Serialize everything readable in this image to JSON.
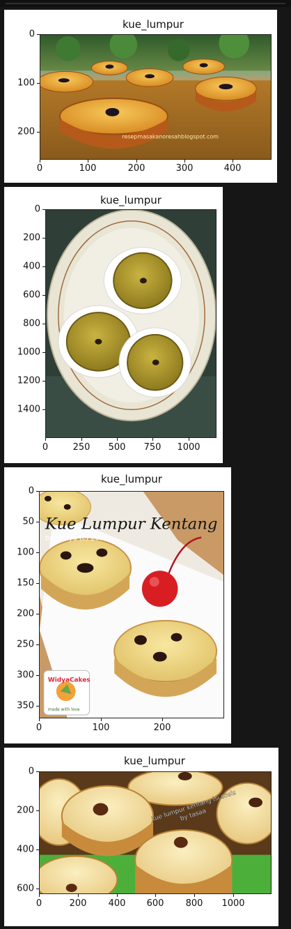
{
  "panels": [
    {
      "title": "kue_lumpur",
      "yticks": [
        "0",
        "100",
        "200"
      ],
      "xticks": [
        "0",
        "100",
        "200",
        "300",
        "400"
      ],
      "watermark": "resepmasakanoresahblogspot.com"
    },
    {
      "title": "kue_lumpur",
      "yticks": [
        "0",
        "200",
        "400",
        "600",
        "800",
        "1000",
        "1200",
        "1400"
      ],
      "xticks": [
        "0",
        "250",
        "500",
        "750",
        "1000"
      ]
    },
    {
      "title": "kue_lumpur",
      "yticks": [
        "0",
        "50",
        "100",
        "150",
        "200",
        "250",
        "300",
        "350"
      ],
      "xticks": [
        "0",
        "100",
        "200"
      ],
      "overlay_title": "Kue Lumpur Kentang",
      "overlay_sub": "by Widya (c) 2010",
      "logo_text": "WidyaCakes",
      "logo_sub": "made with love"
    },
    {
      "title": "kue_lumpur",
      "yticks": [
        "0",
        "200",
        "400",
        "600"
      ],
      "xticks": [
        "0",
        "200",
        "400",
        "600",
        "800",
        "1000"
      ],
      "caption_line1": "kue lumpur kentang isi sosis",
      "caption_line2": "by tasaa"
    }
  ]
}
